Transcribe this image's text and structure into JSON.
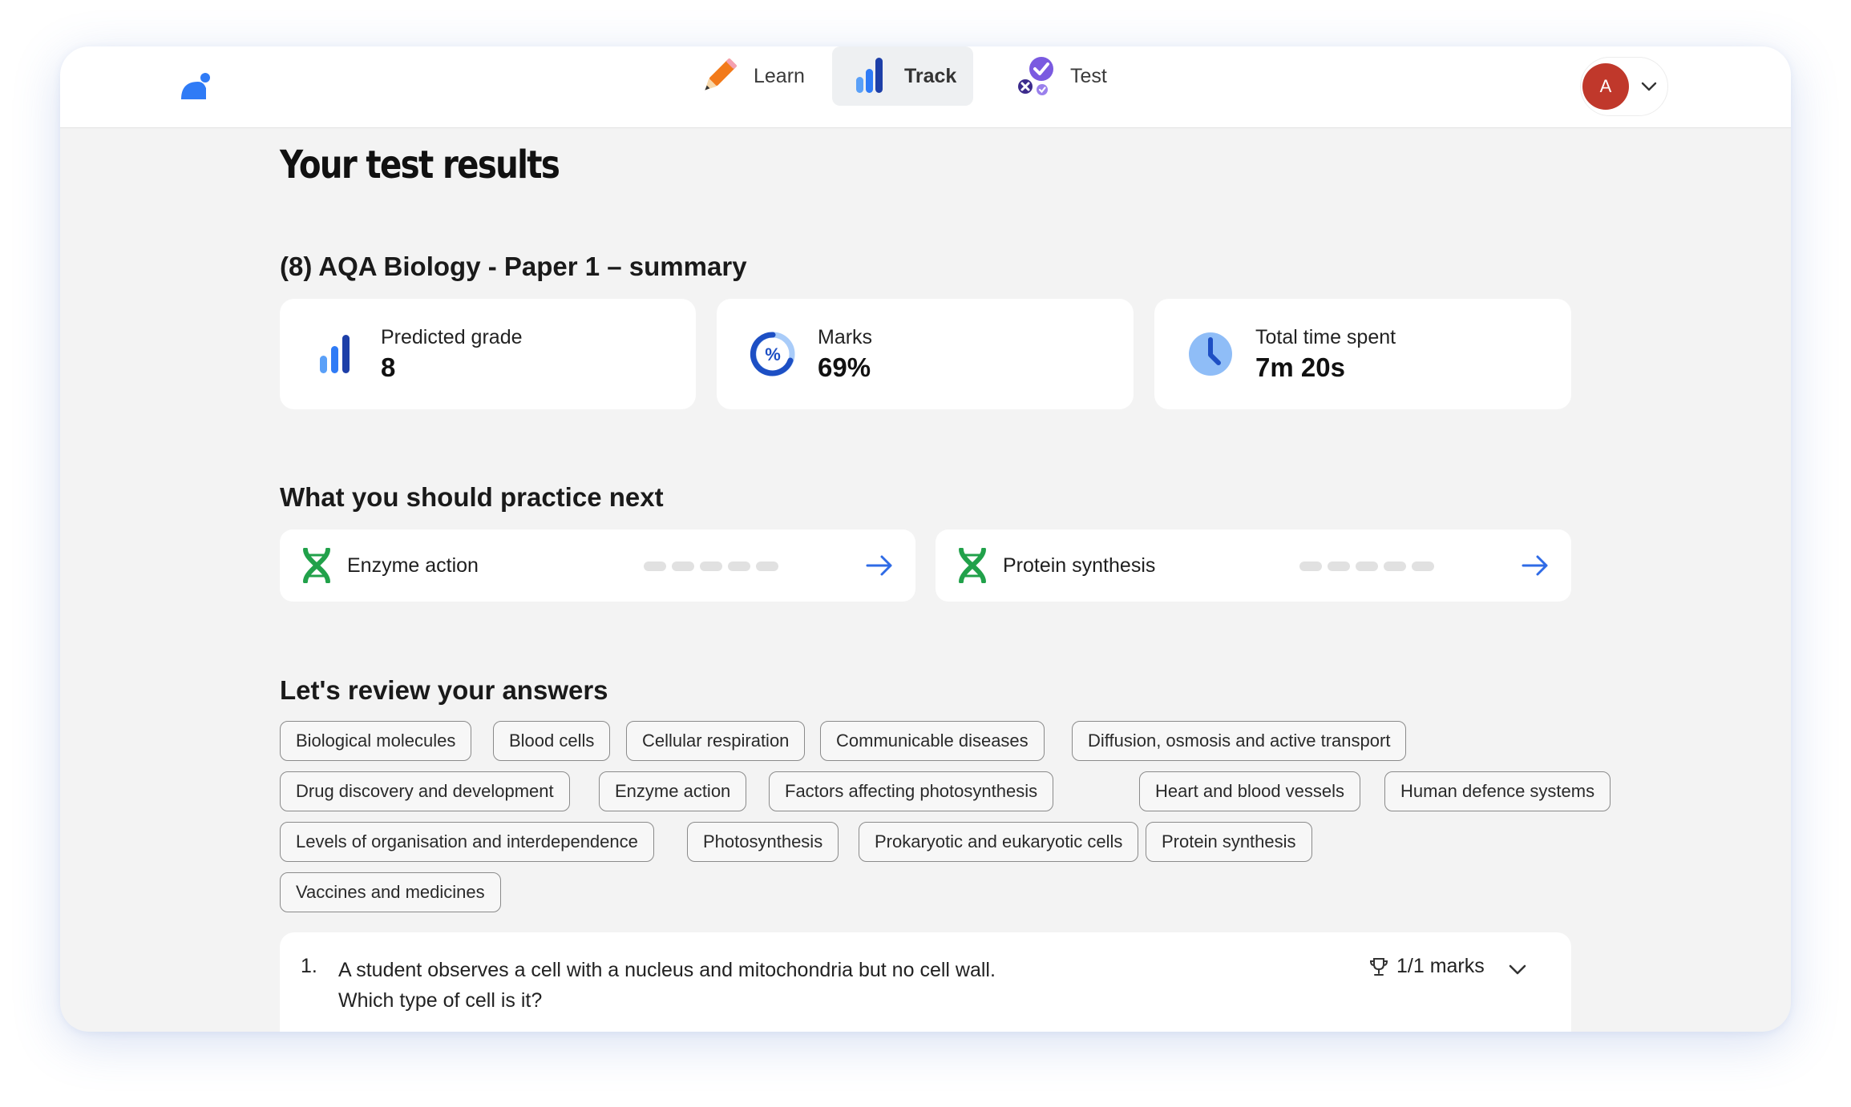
{
  "nav": {
    "learn_label": "Learn",
    "track_label": "Track",
    "test_label": "Test",
    "active": "Track"
  },
  "user": {
    "initial": "A"
  },
  "page": {
    "title": "Your test results"
  },
  "summary": {
    "title": "(8) AQA Biology - Paper 1 – summary",
    "stats": [
      {
        "label": "Predicted grade",
        "value": "8",
        "icon": "bar-chart-icon"
      },
      {
        "label": "Marks",
        "value": "69%",
        "icon": "percent-ring-icon"
      },
      {
        "label": "Total time spent",
        "value": "7m 20s",
        "icon": "clock-icon"
      }
    ]
  },
  "practice": {
    "title": "What you should practice next",
    "items": [
      {
        "name": "Enzyme action",
        "progress_filled": 0,
        "progress_total": 5
      },
      {
        "name": "Protein synthesis",
        "progress_filled": 0,
        "progress_total": 5
      }
    ]
  },
  "review": {
    "title": "Let's review your answers",
    "topics": [
      "Biological molecules",
      "Blood cells",
      "Cellular respiration",
      "Communicable diseases",
      "Diffusion, osmosis and active transport",
      "Drug discovery and development",
      "Enzyme action",
      "Factors affecting photosynthesis",
      "Heart and blood vessels",
      "Human defence systems",
      "Levels of organisation and interdependence",
      "Photosynthesis",
      "Prokaryotic and eukaryotic cells",
      "Protein synthesis",
      "Vaccines and medicines"
    ],
    "questions": [
      {
        "number": "1.",
        "line1": "A student observes a cell with a nucleus and mitochondria but no cell wall.",
        "line2": "Which type of cell is it?",
        "marks": "1/1 marks"
      }
    ]
  },
  "colors": {
    "primary_blue": "#2f7bf6",
    "dark_blue": "#1d4fc4",
    "light_blue": "#8fbdf7",
    "avatar_red": "#c0382b",
    "dna_green": "#21a14a",
    "learn_orange": "#f27a1a",
    "test_purple": "#7a5ae0"
  }
}
